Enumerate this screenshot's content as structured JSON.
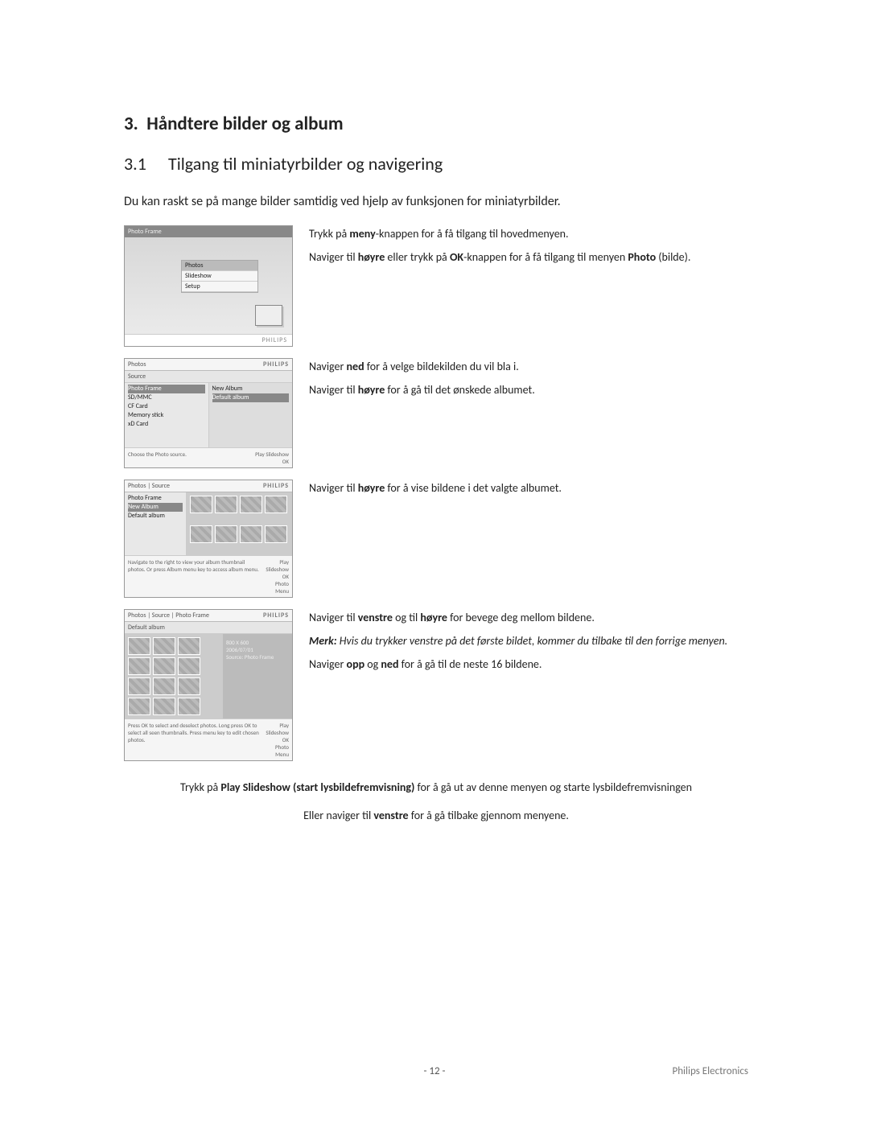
{
  "chapter": {
    "num": "3.",
    "title": "Håndtere bilder og album"
  },
  "section": {
    "num": "3.1",
    "title": "Tilgang til miniatyrbilder og navigering"
  },
  "intro": "Du kan raskt se på mange bilder samtidig ved hjelp av funksjonen for miniatyrbilder.",
  "brand": "PHILIPS",
  "shot1": {
    "title": "Photo Frame",
    "options": [
      "Photos",
      "Slideshow",
      "Setup"
    ]
  },
  "shot2": {
    "header_left": "Photos",
    "left_label": "Source",
    "left_items": [
      "Photo Frame",
      "SD/MMC",
      "CF Card",
      "Memory stick",
      "xD Card"
    ],
    "right_items": [
      "New Album",
      "Default album"
    ],
    "foot_left": "Choose the Photo source.",
    "foot_r1": "Play Slideshow",
    "foot_r2": "OK"
  },
  "shot3": {
    "header_left": "Photos | Source",
    "left_items": [
      "Photo Frame",
      "New Album",
      "Default album"
    ],
    "foot_left": "Navigate to the right to view your album thumbnail photos. Or press Album menu key to access album menu.",
    "foot_r1": "Play Slideshow",
    "foot_r2": "OK",
    "foot_r3": "Photo Menu"
  },
  "shot4": {
    "header_left": "Photos | Source | Photo Frame",
    "left_label": "Default album",
    "info1": "800 X 600",
    "info2": "2006/07/01",
    "info3": "Source: Photo Frame",
    "foot_left": "Press OK to select and deselect photos. Long press OK to select all seen thumbnails. Press menu key to edit chosen photos.",
    "foot_r1": "Play Slideshow",
    "foot_r2": "OK",
    "foot_r3": "Photo Menu"
  },
  "step1": {
    "a_pre": "Trykk på ",
    "a_bold": "meny",
    "a_post": "-knappen for å få tilgang til hovedmenyen.",
    "b_pre": "Naviger til ",
    "b_b1": "høyre",
    "b_mid": " eller trykk på ",
    "b_b2": "OK",
    "b_post": "-knappen for å få tilgang til menyen ",
    "b_b3": "Photo",
    "b_end": " (bilde)."
  },
  "step2": {
    "a_pre": "Naviger ",
    "a_bold": "ned",
    "a_post": " for å velge bildekilden du vil bla i.",
    "b_pre": "Naviger til ",
    "b_bold": "høyre",
    "b_post": " for å gå til det ønskede albumet."
  },
  "step3": {
    "a_pre": "Naviger til ",
    "a_bold": "høyre",
    "a_post": " for å vise bildene i det valgte albumet."
  },
  "step4": {
    "a_pre": "Naviger til ",
    "a_b1": "venstre",
    "a_mid": " og til ",
    "a_b2": "høyre",
    "a_post": " for bevege deg mellom bildene.",
    "note_b": "Merk:",
    "note_rest": " Hvis du trykker venstre på det første bildet, kommer du tilbake til den forrige menyen.",
    "c_pre": "Naviger ",
    "c_b1": "opp",
    "c_mid": " og ",
    "c_b2": "ned",
    "c_post": " for å gå til de neste 16 bildene."
  },
  "closing": {
    "a_pre": "Trykk på ",
    "a_bold": "Play Slideshow (start lysbildefremvisning)",
    "a_post": " for å gå ut av denne menyen og starte lysbildefremvisningen",
    "b_pre": "Eller naviger til ",
    "b_bold": "venstre",
    "b_post": " for å gå tilbake gjennom menyene."
  },
  "footer": {
    "page": "- 12 -",
    "company": "Philips Electronics"
  }
}
